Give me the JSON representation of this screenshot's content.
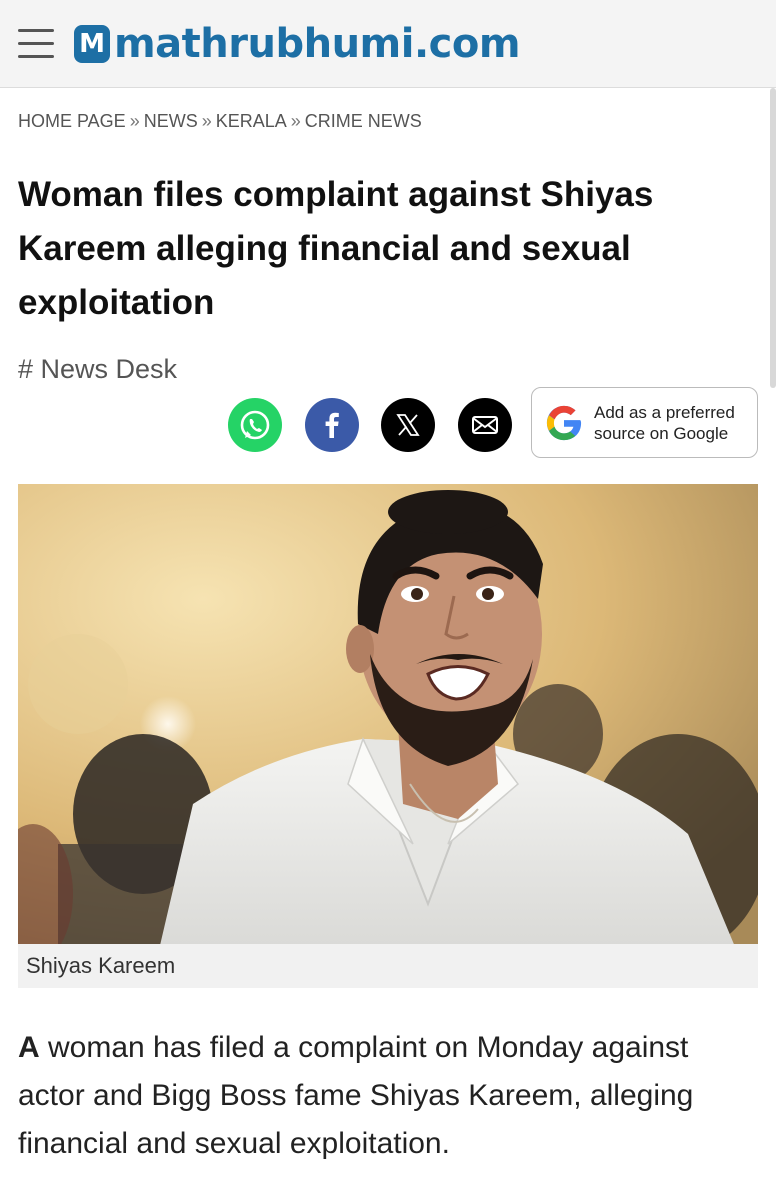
{
  "header": {
    "logo_badge": "M",
    "logo_text": "mathrubhumi.com",
    "brand_color": "#1d6fa5"
  },
  "breadcrumb": [
    {
      "label": "HOME PAGE"
    },
    {
      "label": "NEWS"
    },
    {
      "label": "KERALA"
    },
    {
      "label": "CRIME NEWS"
    }
  ],
  "breadcrumb_separator": "»",
  "article": {
    "title": "Woman files complaint against Shiyas Kareem alleging financial and sexual exploitation",
    "author": "# News Desk",
    "image_caption": "Shiyas Kareem",
    "lead_first_word": "A",
    "lead_rest": " woman has filed a complaint on Monday against actor and Bigg Boss fame Shiyas Kareem, alleging financial and sexual exploitation."
  },
  "share": {
    "icons": [
      "whatsapp-icon",
      "facebook-icon",
      "x-icon",
      "mail-icon"
    ],
    "google_button": {
      "line1": "Add as a preferred",
      "line2": "source on Google"
    },
    "colors": {
      "whatsapp": "#25d366",
      "facebook": "#3b5aa8",
      "x": "#000000",
      "mail": "#000000"
    }
  }
}
